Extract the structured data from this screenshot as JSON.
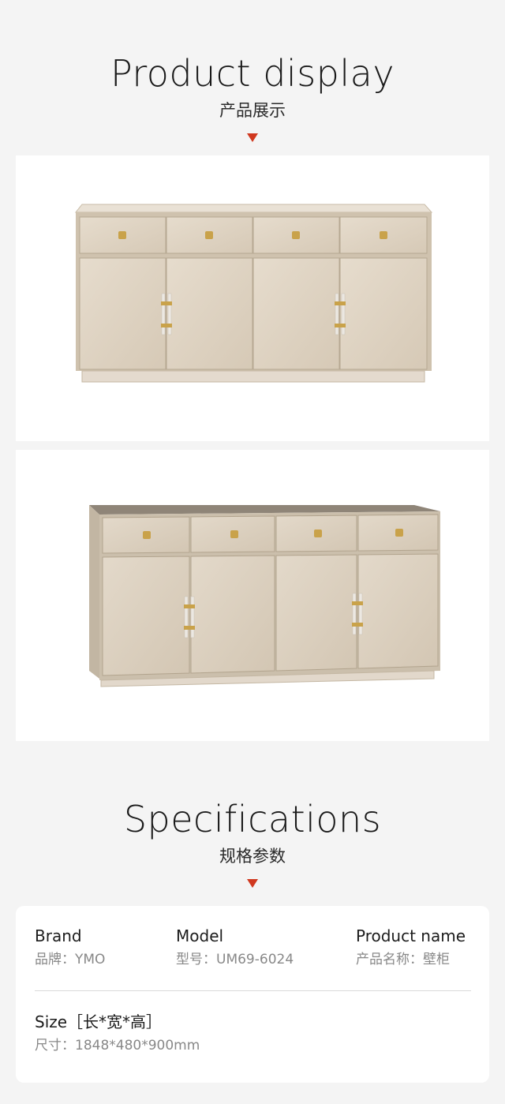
{
  "display_section": {
    "title_en": "Product display",
    "title_cn": "产品展示",
    "images": [
      {
        "icon": "sideboard-front-view-image"
      },
      {
        "icon": "sideboard-angled-view-image"
      }
    ]
  },
  "specs_section": {
    "title_en": "Specifications",
    "title_cn": "规格参数",
    "brand": {
      "label": "Brand",
      "value": "品牌：YMO"
    },
    "model": {
      "label": "Model",
      "value": "型号：UM69-6024"
    },
    "product_name": {
      "label": "Product name",
      "value": "产品名称：壁柜"
    },
    "size": {
      "label": "Size［长*宽*高］",
      "value": "尺寸：1848*480*900mm"
    }
  },
  "colors": {
    "accent": "#d0381f",
    "cabinet": "#ddd1c1",
    "handle_gold": "#c9a24a"
  }
}
